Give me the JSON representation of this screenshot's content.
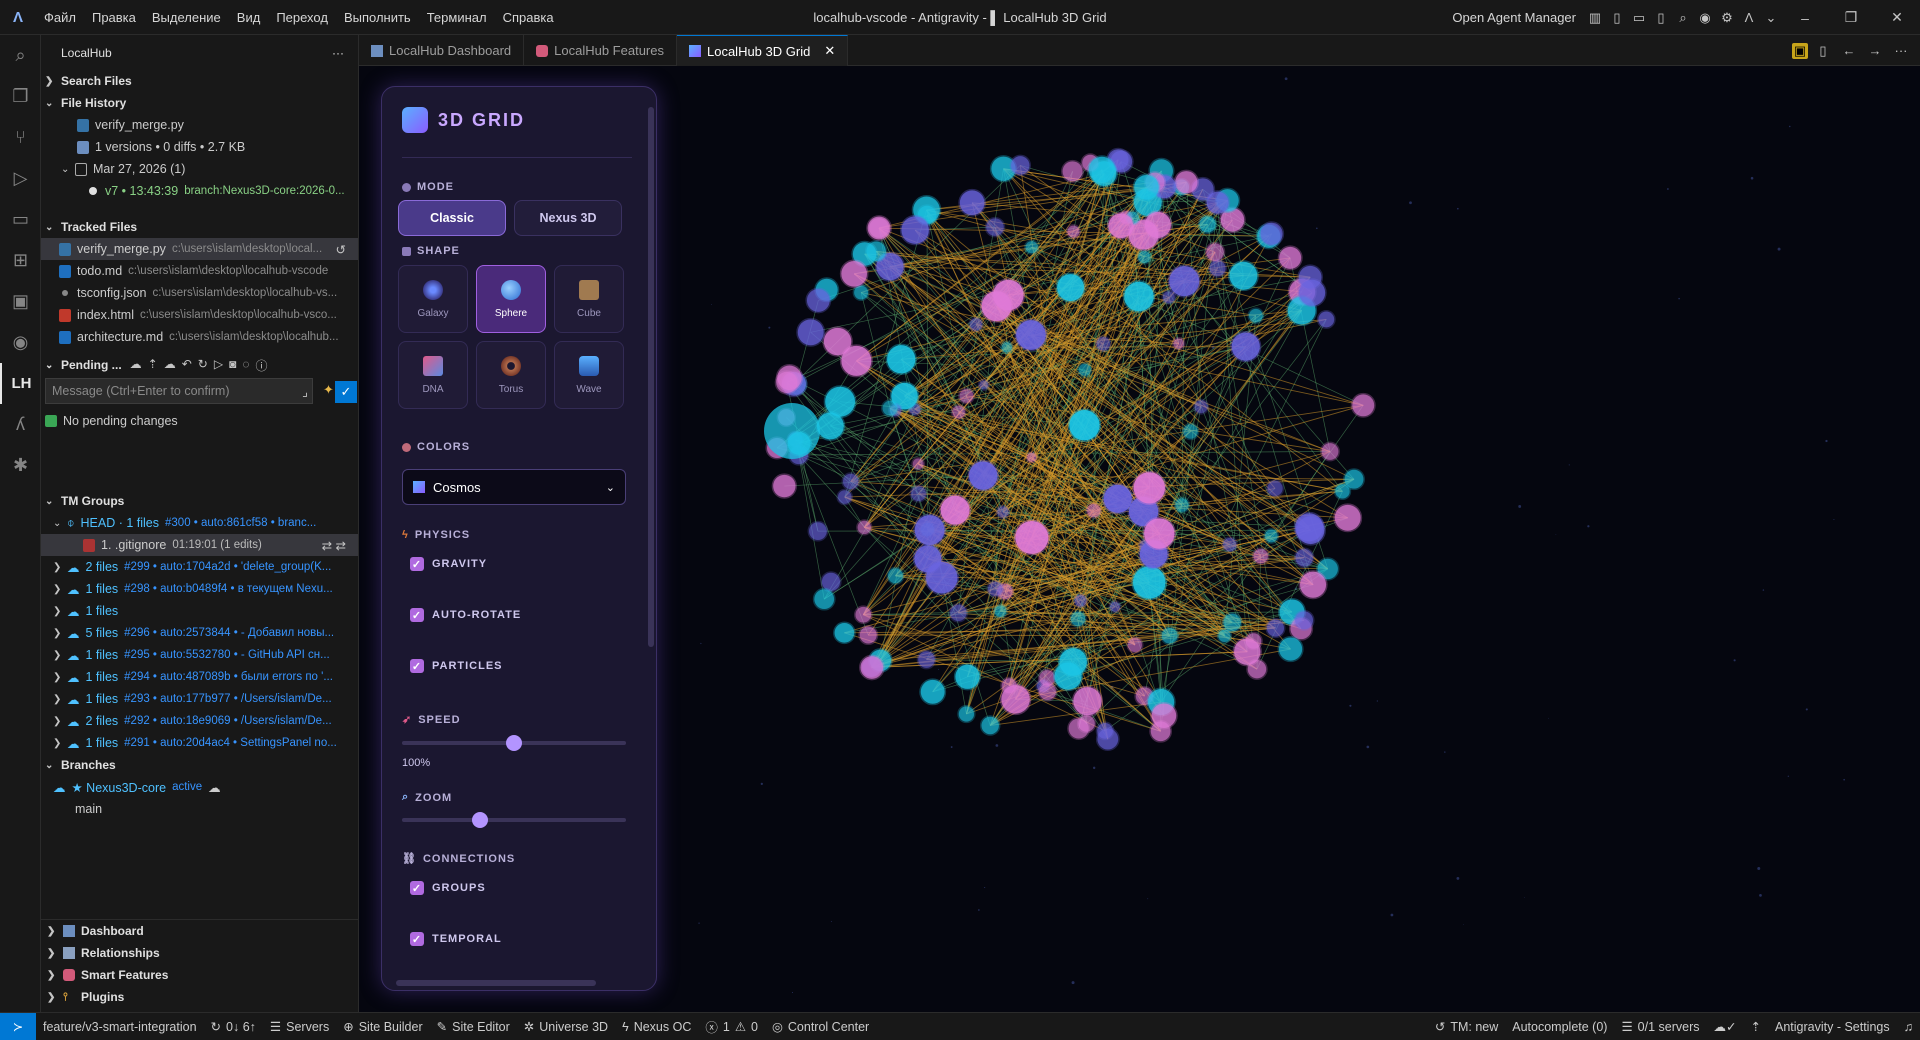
{
  "window": {
    "title": "localhub-vscode - Antigravity - ▌ LocalHub 3D Grid",
    "agent_manager": "Open Agent Manager"
  },
  "menu": [
    "Файл",
    "Правка",
    "Выделение",
    "Вид",
    "Переход",
    "Выполнить",
    "Терминал",
    "Справка"
  ],
  "sidebar": {
    "title": "LocalHub",
    "search_files": "Search Files",
    "file_history": {
      "title": "File History",
      "file": "verify_merge.py",
      "stats": "1 versions • 0 diffs • 2.7 KB",
      "date": "Mar 27, 2026 (1)",
      "version": "v7 • 13:43:39",
      "branch": "branch:Nexus3D-core:2026-0..."
    },
    "tracked": {
      "title": "Tracked Files",
      "files": [
        {
          "name": "verify_merge.py",
          "path": "c:\\users\\islam\\desktop\\local..."
        },
        {
          "name": "todo.md",
          "path": "c:\\users\\islam\\desktop\\localhub-vscode"
        },
        {
          "name": "tsconfig.json",
          "path": "c:\\users\\islam\\desktop\\localhub-vs..."
        },
        {
          "name": "index.html",
          "path": "c:\\users\\islam\\desktop\\localhub-vsco..."
        },
        {
          "name": "architecture.md",
          "path": "c:\\users\\islam\\desktop\\localhub..."
        }
      ]
    },
    "pending": {
      "title": "Pending ...",
      "placeholder": "Message (Ctrl+Enter to confirm)",
      "empty": "No pending changes"
    },
    "tm_groups": {
      "title": "TM Groups",
      "head": {
        "label": "HEAD · 1 files",
        "meta": "#300 • auto:861cf58 • branc..."
      },
      "head_file": {
        "name": "1. .gitignore",
        "meta": "01:19:01 (1 edits)"
      },
      "items": [
        {
          "label": "2 files",
          "meta": "#299 • auto:1704a2d • 'delete_group(K..."
        },
        {
          "label": "1 files",
          "meta": "#298 • auto:b0489f4 • в текущем Nexu..."
        },
        {
          "label": "1 files",
          "meta": ""
        },
        {
          "label": "5 files",
          "meta": "#296 • auto:2573844 • - Добавил новы..."
        },
        {
          "label": "1 files",
          "meta": "#295 • auto:5532780 • - GitHub API сн..."
        },
        {
          "label": "1 files",
          "meta": "#294 • auto:487089b • были errors по '..."
        },
        {
          "label": "1 files",
          "meta": "#293 • auto:177b977 • /Users/islam/De..."
        },
        {
          "label": "2 files",
          "meta": "#292 • auto:18e9069 • /Users/islam/De..."
        },
        {
          "label": "1 files",
          "meta": "#291 • auto:20d4ac4 • SettingsPanel no..."
        }
      ]
    },
    "branches": {
      "title": "Branches",
      "active": "★ Nexus3D-core",
      "active_tag": "active",
      "main": "main"
    },
    "bottom_sections": [
      "Dashboard",
      "Relationships",
      "Smart Features",
      "Plugins"
    ]
  },
  "tabs": [
    {
      "label": "LocalHub Dashboard"
    },
    {
      "label": "LocalHub Features"
    },
    {
      "label": "LocalHub 3D Grid"
    }
  ],
  "panel": {
    "title": "3D GRID",
    "mode_label": "MODE",
    "modes": [
      "Classic",
      "Nexus 3D"
    ],
    "active_mode": "Classic",
    "shape_label": "SHAPE",
    "shapes": [
      "Galaxy",
      "Sphere",
      "Cube",
      "DNA",
      "Torus",
      "Wave"
    ],
    "active_shape": "Sphere",
    "colors_label": "COLORS",
    "color_value": "Cosmos",
    "physics_label": "PHYSICS",
    "gravity": "GRAVITY",
    "auto_rotate": "AUTO-ROTATE",
    "particles": "PARTICLES",
    "speed_label": "SPEED",
    "speed_value": "100%",
    "speed_level": 0.5,
    "zoom_label": "ZOOM",
    "zoom_level": 0.35,
    "connections_label": "CONNECTIONS",
    "groups": "GROUPS",
    "temporal": "TEMPORAL"
  },
  "colors": {
    "accent": "#0078d4",
    "purple": "#b394ff",
    "link_green": "#5aa86a",
    "link_orange": "#d79a2a",
    "node_cyan": "#1cc6e6",
    "node_pink": "#e07ad8",
    "node_violet": "#6a64e0"
  },
  "status": {
    "branch": "feature/v3-smart-integration",
    "sync": "0↓ 6↑",
    "servers": "Servers",
    "site_builder": "Site Builder",
    "site_editor": "Site Editor",
    "universe": "Universe 3D",
    "nexus": "Nexus OC",
    "errors": "1",
    "warnings": "0",
    "control": "Control Center",
    "tm": "TM: new",
    "autocomplete": "Autocomplete (0)",
    "servers_count": "0/1 servers",
    "settings": "Antigravity - Settings"
  }
}
